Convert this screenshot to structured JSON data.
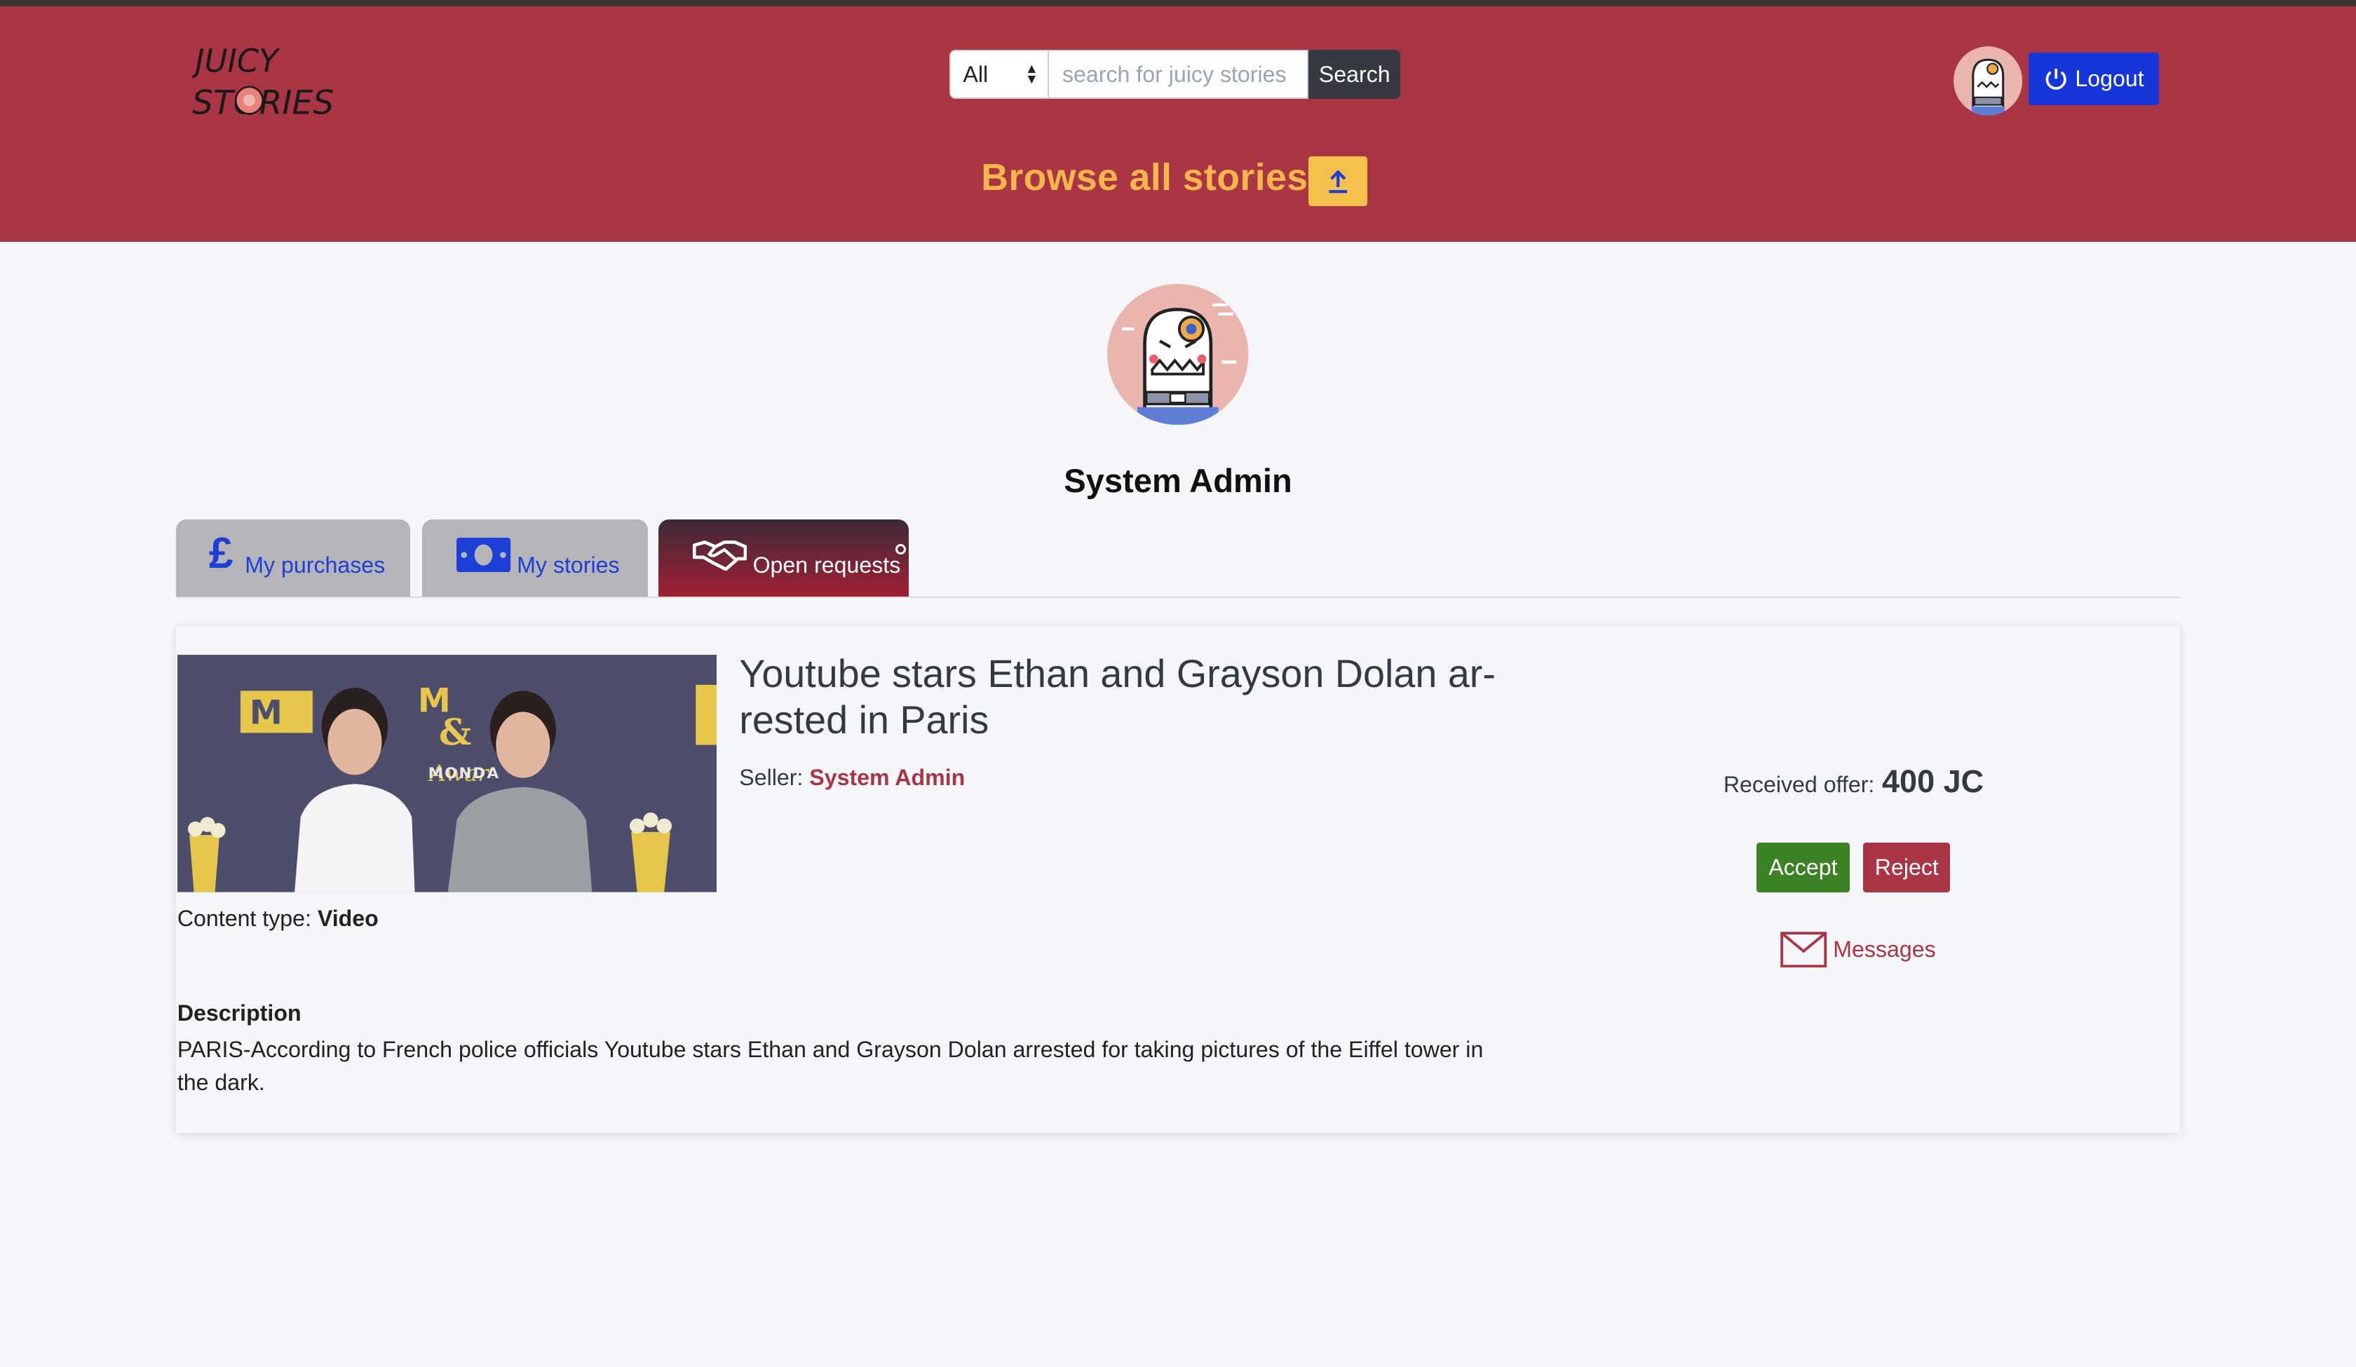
{
  "header": {
    "logo_text_line1": "JUICY",
    "logo_text_line2": "STORIES",
    "search": {
      "category_selected": "All",
      "placeholder": "search for juicy stories",
      "button_label": "Search"
    },
    "browse_title": "Browse all stories",
    "upload_icon": "upload-icon",
    "logout_label": "Logout",
    "logout_icon": "power-icon"
  },
  "profile": {
    "name": "System Admin"
  },
  "tabs": [
    {
      "label": "My purchases",
      "icon": "pound-icon"
    },
    {
      "label": "My stories",
      "icon": "banknote-icon"
    },
    {
      "label": "Open requests",
      "icon": "handshake-icon"
    }
  ],
  "request": {
    "title": "Youtube stars Ethan and Grayson Dolan ar-rested in Paris",
    "seller_label": "Seller:",
    "seller_name": "System Admin",
    "content_type_label": "Content type:",
    "content_type_value": "Video",
    "description_heading": "Description",
    "description": "PARIS-According to French police officials Youtube stars Ethan and Grayson Dolan arrested for taking pictures of the Eiffel tower in the dark.",
    "offer_label": "Received offer:",
    "offer_value": "400 JC",
    "accept_label": "Accept",
    "reject_label": "Reject",
    "messages_label": "Messages",
    "image_text": "MONDA"
  },
  "colors": {
    "header_bg": "#a93545",
    "accent_yellow": "#f6b64b",
    "logout_blue": "#1736d9",
    "accept_green": "#3d8125",
    "reject_red": "#a93545",
    "search_dark": "#343a40"
  }
}
